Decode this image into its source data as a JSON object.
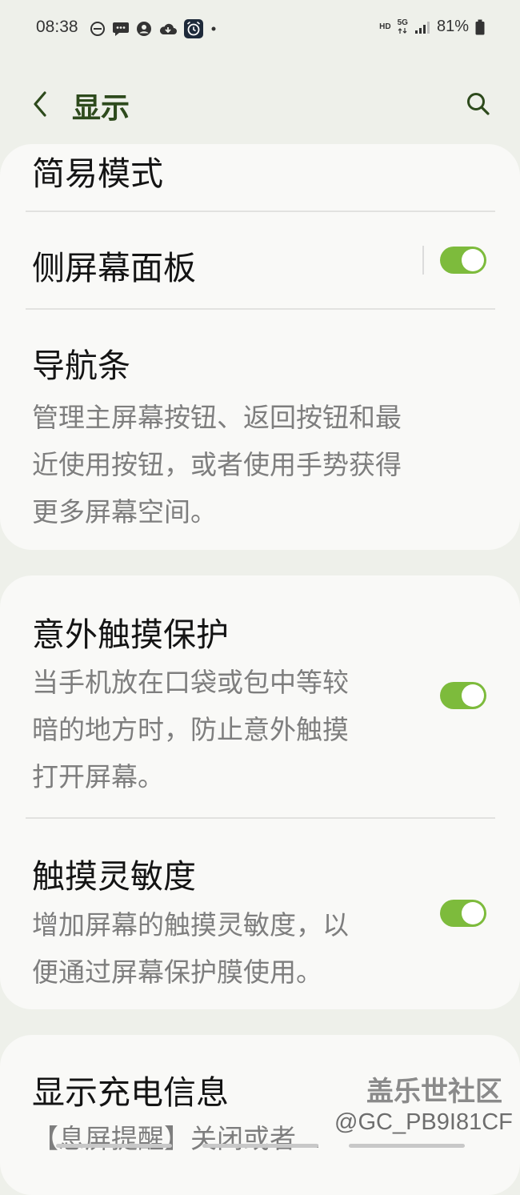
{
  "status_bar": {
    "time": "08:38",
    "icons": [
      "dnd-icon",
      "message-icon",
      "account-icon",
      "cloud-icon",
      "alarm-app-icon",
      "dot-icon"
    ],
    "hd": "HD",
    "network": "5G",
    "battery": "81%"
  },
  "header": {
    "title": "显示"
  },
  "settings": {
    "easy_mode": {
      "title": "简易模式"
    },
    "edge_panels": {
      "title": "侧屏幕面板",
      "enabled": true
    },
    "navigation_bar": {
      "title": "导航条",
      "desc_lines": [
        "管理主屏幕按钮、返回按钮和最",
        "近使用按钮，或者使用手势获得",
        "更多屏幕空间。"
      ]
    },
    "accidental_touch": {
      "title": "意外触摸保护",
      "desc_lines": [
        "当手机放在口袋或包中等较",
        "暗的地方时，防止意外触摸",
        "打开屏幕。"
      ],
      "enabled": true
    },
    "touch_sensitivity": {
      "title": "触摸灵敏度",
      "desc_lines": [
        "增加屏幕的触摸灵敏度，以",
        "便通过屏幕保护膜使用。"
      ],
      "enabled": true
    },
    "charging_info": {
      "title": "显示充电信息",
      "desc_partial": "【息屏提醒】关闭或者..."
    }
  },
  "watermark": {
    "line1": "盖乐世社区",
    "line2": "@GC_PB9I81CF"
  },
  "colors": {
    "accent_green": "#7dbb3c",
    "title_green": "#2d4a1c",
    "background": "#eef0ea",
    "card": "#f9f9f7"
  }
}
